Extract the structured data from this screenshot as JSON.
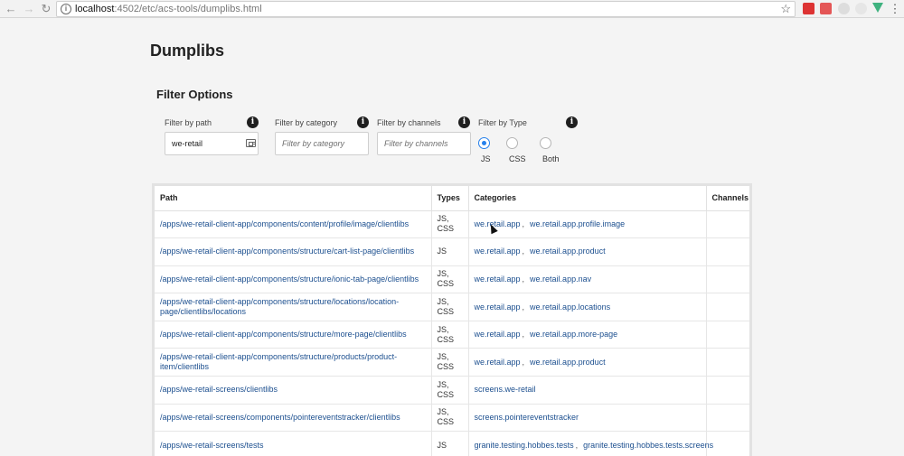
{
  "browser": {
    "url_host": "localhost",
    "url_path": ":4502/etc/acs-tools/dumplibs.html"
  },
  "page": {
    "title": "Dumplibs",
    "filter_section": "Filter Options"
  },
  "filters": {
    "path": {
      "label": "Filter by path",
      "value": "we-retail",
      "placeholder": ""
    },
    "category": {
      "label": "Filter by category",
      "value": "",
      "placeholder": "Filter by category"
    },
    "channels": {
      "label": "Filter by channels",
      "value": "",
      "placeholder": "Filter by channels"
    },
    "type": {
      "label": "Filter by Type",
      "options": [
        "JS",
        "CSS",
        "Both"
      ],
      "selected": "JS"
    }
  },
  "table": {
    "columns": [
      "Path",
      "Types",
      "Categories",
      "Channels"
    ],
    "rows": [
      {
        "path": "/apps/we-retail-client-app/components/content/profile/image/clientlibs",
        "types": "JS, CSS",
        "categories": [
          "we.retail.app",
          "we.retail.app.profile.image"
        ],
        "channels": ""
      },
      {
        "path": "/apps/we-retail-client-app/components/structure/cart-list-page/clientlibs",
        "types": "JS",
        "categories": [
          "we.retail.app",
          "we.retail.app.product"
        ],
        "channels": ""
      },
      {
        "path": "/apps/we-retail-client-app/components/structure/ionic-tab-page/clientlibs",
        "types": "JS, CSS",
        "categories": [
          "we.retail.app",
          "we.retail.app.nav"
        ],
        "channels": ""
      },
      {
        "path": "/apps/we-retail-client-app/components/structure/locations/location-page/clientlibs/locations",
        "types": "JS, CSS",
        "categories": [
          "we.retail.app",
          "we.retail.app.locations"
        ],
        "channels": ""
      },
      {
        "path": "/apps/we-retail-client-app/components/structure/more-page/clientlibs",
        "types": "JS, CSS",
        "categories": [
          "we.retail.app",
          "we.retail.app.more-page"
        ],
        "channels": ""
      },
      {
        "path": "/apps/we-retail-client-app/components/structure/products/product-item/clientlibs",
        "types": "JS, CSS",
        "categories": [
          "we.retail.app",
          "we.retail.app.product"
        ],
        "channels": ""
      },
      {
        "path": "/apps/we-retail-screens/clientlibs",
        "types": "JS, CSS",
        "categories": [
          "screens.we-retail"
        ],
        "channels": ""
      },
      {
        "path": "/apps/we-retail-screens/components/pointereventstracker/clientlibs",
        "types": "JS, CSS",
        "categories": [
          "screens.pointereventstracker"
        ],
        "channels": ""
      },
      {
        "path": "/apps/we-retail-screens/tests",
        "types": "JS",
        "categories": [
          "granite.testing.hobbes.tests",
          "granite.testing.hobbes.tests.screens"
        ],
        "channels": ""
      }
    ]
  },
  "icons": {
    "info": "info-icon",
    "tag": "tag-icon",
    "star": "bookmark-star-icon"
  },
  "colors": {
    "accent": "#2680eb",
    "link": "#1c4f8f"
  }
}
